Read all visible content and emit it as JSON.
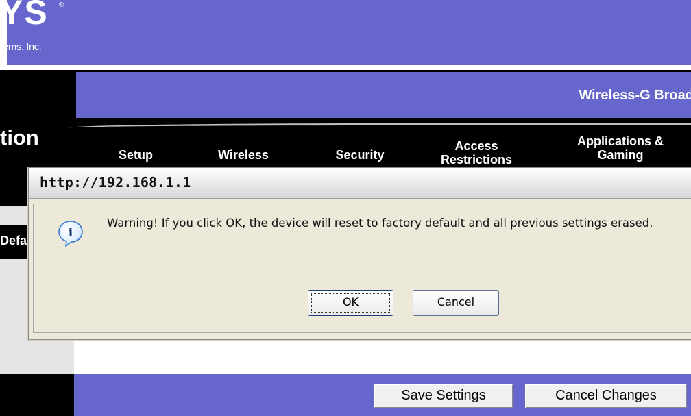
{
  "brand": {
    "logo_text": "YS",
    "registered_mark": "®",
    "subtitle": "ems, Inc."
  },
  "page": {
    "product_name": "Wireless-G Broad",
    "section_title": "tion",
    "sub_nav_label": "Defa"
  },
  "nav_tabs": [
    {
      "label": "Setup"
    },
    {
      "label": "Wireless"
    },
    {
      "label": "Security"
    },
    {
      "label": "Access Restrictions"
    },
    {
      "label": "Applications & Gaming"
    }
  ],
  "footer": {
    "save_label": "Save Settings",
    "cancel_label": "Cancel Changes"
  },
  "dialog": {
    "title": "http://192.168.1.1",
    "icon": "info-icon",
    "message": "Warning! If you click OK, the device will reset to factory default and all previous settings erased.",
    "ok_label": "OK",
    "cancel_label": "Cancel"
  },
  "colors": {
    "brand_purple": "#6666cc",
    "black": "#000000",
    "dialog_bg": "#ece9d8"
  }
}
